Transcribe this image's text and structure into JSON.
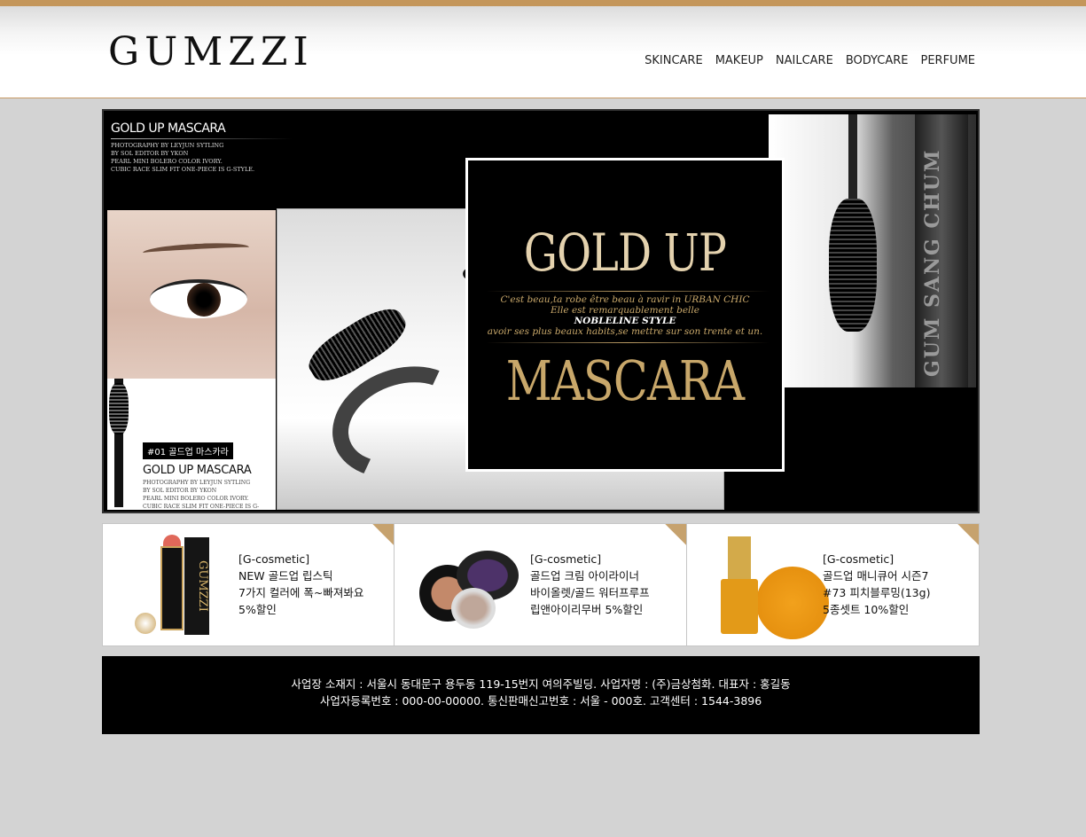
{
  "header": {
    "logo": "GUMZZI",
    "nav": [
      "SKINCARE",
      "MAKEUP",
      "NAILCARE",
      "BODYCARE",
      "PERFUME"
    ]
  },
  "banner": {
    "top_left_title": "GOLD UP MASCARA",
    "top_left_credits": [
      "PHOTOGRAPHY BY LEYJUN SYTLING",
      "BY SOL EDITOR BY YKON",
      "PEARL MINI BOLERO COLOR IVORY.",
      "CUBIC RACE SLIM FIT ONE-PIECE IS G-STYLE."
    ],
    "tag": "#01 골드업 마스카라",
    "lower_title": "GOLD UP MASCARA",
    "lower_credits": [
      "PHOTOGRAPHY BY LEYJUN SYTLING",
      "BY SOL EDITOR BY YKON",
      "PEARL MINI BOLERO COLOR IVORY.",
      "CUBIC RACE SLIM FIT ONE-PIECE IS G-"
    ],
    "headline_top": "GOLD UP",
    "tagline_1": "C'est beau,ta robe être beau à ravir in URBAN CHIC",
    "tagline_2": "Elle est remarquablement belle",
    "tagline_3": "NOBLELINE STYLE",
    "tagline_4": "avoir ses plus beaux habits,se  mettre sur son trente et un.",
    "headline_bottom": "MASCARA",
    "tube_text": "GUM SANG CHUM"
  },
  "products": [
    {
      "brand": "[G-cosmetic]",
      "line1": "NEW 골드업 립스틱",
      "line2": "7가지 컬러에 폭~빠져봐요",
      "line3": "5%할인"
    },
    {
      "brand": "[G-cosmetic]",
      "line1": "골드업 크림 아이라이너",
      "line2": "바이올렛/골드 워터프루프",
      "line3": "립앤아이리무버 5%할인"
    },
    {
      "brand": "[G-cosmetic]",
      "line1": "골드업 매니큐어 시즌7",
      "line2": "#73 피치블루밍(13g)",
      "line3": "5종셋트 10%할인"
    }
  ],
  "lipstick_brand_text": "GUMZZI",
  "footer": {
    "line1": "사업장 소재지 : 서울시 동대문구 용두동 119-15번지 여의주빌딩. 사업자명 : (주)금상첨화. 대표자 : 홍길동",
    "line2": "사업자등록번호 : 000-00-00000. 통신판매신고번호 : 서울 - 000호. 고객센터 : 1544-3896"
  },
  "colors": {
    "accent_gold": "#c4965a",
    "banner_gold": "#c8a76a",
    "background": "#d3d3d3"
  }
}
